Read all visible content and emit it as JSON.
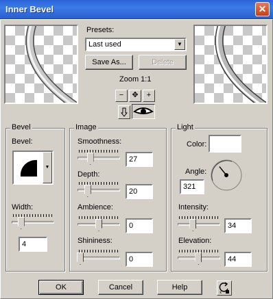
{
  "window": {
    "title": "Inner Bevel",
    "close_label": "✕"
  },
  "presets": {
    "label": "Presets:",
    "value": "Last used",
    "save_as_label": "Save As...",
    "delete_label": "Delete"
  },
  "zoom": {
    "label": "Zoom 1:1",
    "zoom_out_symbol": "−",
    "pan_symbol": "✥",
    "zoom_in_symbol": "+"
  },
  "bevel": {
    "group_label": "Bevel",
    "bevel_label": "Bevel:",
    "width_label": "Width:",
    "width_value": "4",
    "width_level": 0.18
  },
  "image": {
    "group_label": "Image",
    "smoothness_label": "Smoothness:",
    "smoothness_value": "27",
    "smoothness_level": 0.27,
    "depth_label": "Depth:",
    "depth_value": "20",
    "depth_level": 0.2,
    "ambience_label": "Ambience:",
    "ambience_value": "0",
    "ambience_level": 0.5,
    "shininess_label": "Shininess:",
    "shininess_value": "0",
    "shininess_level": 0.0
  },
  "light": {
    "group_label": "Light",
    "color_label": "Color:",
    "color_value": "#ffffff",
    "angle_label": "Angle:",
    "angle_value": "321",
    "intensity_label": "Intensity:",
    "intensity_value": "34",
    "intensity_level": 0.34,
    "elevation_label": "Elevation:",
    "elevation_value": "44",
    "elevation_level": 0.49
  },
  "footer": {
    "ok_label": "OK",
    "cancel_label": "Cancel",
    "help_label": "Help",
    "reset_icon": "reset-icon"
  },
  "colors": {
    "title_bar": "#2a64d8",
    "face": "#d4d0c8"
  }
}
